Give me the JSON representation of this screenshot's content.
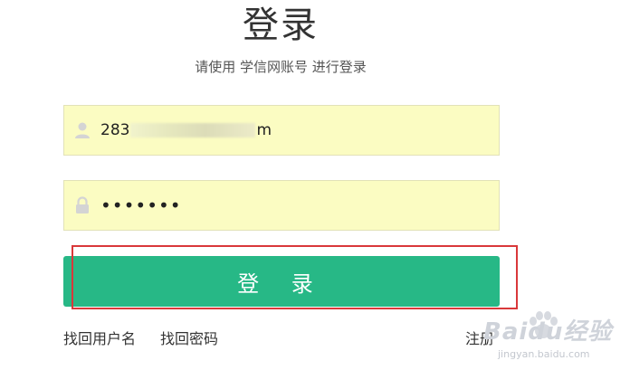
{
  "header": {
    "title": "登录",
    "subtitle": "请使用 学信网账号 进行登录"
  },
  "form": {
    "username_prefix": "283",
    "username_suffix": "m",
    "password_masked": "•••••••",
    "login_button_label": "登 录"
  },
  "links": {
    "find_username": "找回用户名",
    "find_password": "找回密码",
    "register": "注册"
  },
  "watermark": {
    "brand": "Baidu经验",
    "url": "jingyan.baidu.com"
  },
  "colors": {
    "button_bg": "#27b886",
    "field_bg": "#fbfcc2",
    "highlight_border": "#d9383a"
  },
  "icons": {
    "username_field": "user-icon",
    "password_field": "lock-icon",
    "watermark": "paw-icon"
  }
}
